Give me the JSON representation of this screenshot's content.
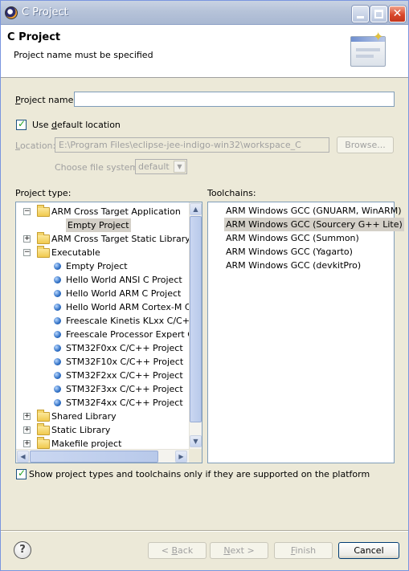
{
  "window": {
    "title": "C Project",
    "icon": "eclipse-icon"
  },
  "banner": {
    "title": "C Project",
    "message": "Project name must be specified",
    "image_icon": "new-project-wizard-icon"
  },
  "form": {
    "project_name_label_prefix": "P",
    "project_name_label_rest": "roject name:",
    "project_name_value": "",
    "use_default_label_prefix": "Use ",
    "use_default_label_underline": "d",
    "use_default_label_rest": "efault location",
    "use_default_checked": true,
    "location_label_prefix": "L",
    "location_label_rest": "ocation:",
    "location_value": "E:\\Program Files\\eclipse-jee-indigo-win32\\workspace_C",
    "browse_label": "Browse...",
    "filesystem_label": "Choose file system:",
    "filesystem_value": "default"
  },
  "project_type": {
    "label": "Project type:",
    "items": [
      {
        "label": "ARM Cross Target Application",
        "kind": "folder",
        "expander": "−",
        "level": 0
      },
      {
        "label": "Empty Project",
        "kind": "leaf-none",
        "level": 1,
        "selected": true
      },
      {
        "label": "ARM Cross Target Static Library",
        "kind": "folder",
        "expander": "+",
        "level": 0
      },
      {
        "label": "Executable",
        "kind": "folder",
        "expander": "−",
        "level": 0
      },
      {
        "label": "Empty Project",
        "kind": "dot",
        "level": 1
      },
      {
        "label": "Hello World ANSI C Project",
        "kind": "dot",
        "level": 1
      },
      {
        "label": "Hello World ARM C Project",
        "kind": "dot",
        "level": 1
      },
      {
        "label": "Hello World ARM Cortex-M C/C-",
        "kind": "dot",
        "level": 1
      },
      {
        "label": "Freescale Kinetis KLxx C/C++ F",
        "kind": "dot",
        "level": 1
      },
      {
        "label": "Freescale Processor Expert C/C",
        "kind": "dot",
        "level": 1
      },
      {
        "label": "STM32F0xx C/C++ Project",
        "kind": "dot",
        "level": 1
      },
      {
        "label": "STM32F10x C/C++ Project",
        "kind": "dot",
        "level": 1
      },
      {
        "label": "STM32F2xx C/C++ Project",
        "kind": "dot",
        "level": 1
      },
      {
        "label": "STM32F3xx C/C++ Project",
        "kind": "dot",
        "level": 1
      },
      {
        "label": "STM32F4xx C/C++ Project",
        "kind": "dot",
        "level": 1
      },
      {
        "label": "Shared Library",
        "kind": "folder",
        "expander": "+",
        "level": 0
      },
      {
        "label": "Static Library",
        "kind": "folder",
        "expander": "+",
        "level": 0
      },
      {
        "label": "Makefile project",
        "kind": "folder",
        "expander": "+",
        "level": 0
      }
    ]
  },
  "toolchains": {
    "label": "Toolchains:",
    "items": [
      {
        "label": "ARM Windows GCC (GNUARM, WinARM)",
        "selected": false
      },
      {
        "label": "ARM Windows GCC (Sourcery G++ Lite)",
        "selected": true
      },
      {
        "label": "ARM Windows GCC (Summon)",
        "selected": false
      },
      {
        "label": "ARM Windows GCC (Yagarto)",
        "selected": false
      },
      {
        "label": "ARM Windows GCC (devkitPro)",
        "selected": false
      }
    ]
  },
  "show_supported": {
    "label": "Show project types and toolchains only if they are supported on the platform",
    "checked": true
  },
  "buttons": {
    "help": "?",
    "back_prefix": "< ",
    "back_u": "B",
    "back_rest": "ack",
    "next_u": "N",
    "next_rest": "ext >",
    "finish_u": "F",
    "finish_rest": "inish",
    "cancel": "Cancel"
  }
}
